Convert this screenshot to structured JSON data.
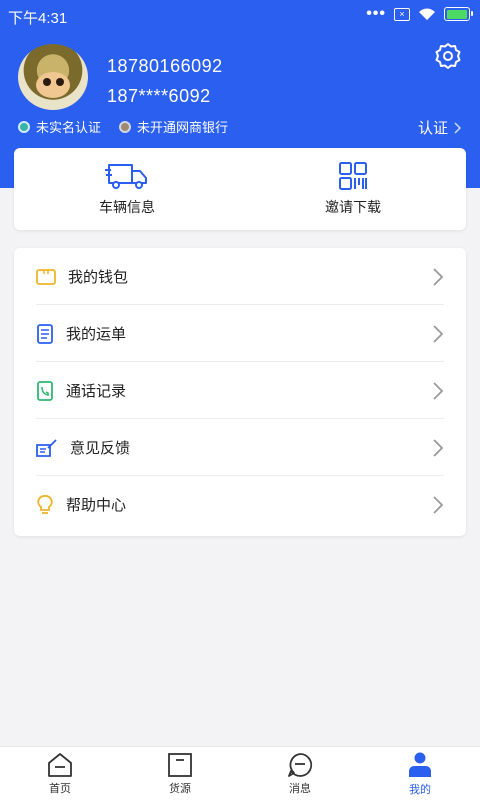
{
  "statusbar": {
    "time": "下午4:31",
    "sim_label": "×"
  },
  "profile": {
    "phone": "18780166092",
    "phone_masked": "187****6092",
    "badges": [
      {
        "label": "未实名认证",
        "dot_color": "#39b3a6"
      },
      {
        "label": "未开通网商银行",
        "dot_color": "#a08a6f"
      }
    ],
    "verify_label": "认证"
  },
  "quick_actions": [
    {
      "label": "车辆信息",
      "icon": "truck-icon"
    },
    {
      "label": "邀请下载",
      "icon": "qr-code-icon"
    }
  ],
  "menu": [
    {
      "label": "我的钱包",
      "icon": "wallet-icon",
      "color": "#f0b429"
    },
    {
      "label": "我的运单",
      "icon": "document-icon",
      "color": "#2a5ff0"
    },
    {
      "label": "通话记录",
      "icon": "phone-log-icon",
      "color": "#2eb872"
    },
    {
      "label": "意见反馈",
      "icon": "feedback-icon",
      "color": "#2a5ff0"
    },
    {
      "label": "帮助中心",
      "icon": "lightbulb-icon",
      "color": "#f0b429"
    }
  ],
  "tabs": [
    {
      "label": "首页",
      "icon": "home-icon"
    },
    {
      "label": "货源",
      "icon": "cargo-icon"
    },
    {
      "label": "消息",
      "icon": "message-icon"
    },
    {
      "label": "我的",
      "icon": "user-icon",
      "active": true
    }
  ],
  "colors": {
    "primary": "#2a5ff0",
    "background": "#f3f3f5"
  }
}
